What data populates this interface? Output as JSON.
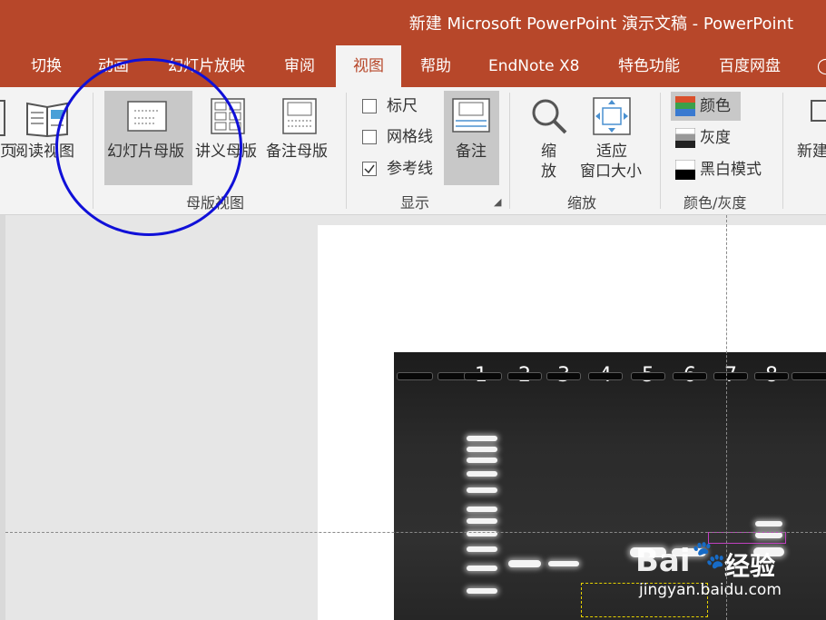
{
  "window": {
    "title": "新建 Microsoft PowerPoint 演示文稿 - PowerPoint"
  },
  "tabs": [
    "切换",
    "动画",
    "幻灯片放映",
    "审阅",
    "视图",
    "帮助",
    "EndNote X8",
    "特色功能",
    "百度网盘"
  ],
  "active_tab": "视图",
  "ribbon": {
    "page_partial": "页",
    "reading_view": "阅读视图",
    "master_views": {
      "slide_master": "幻灯片母版",
      "handout_master": "讲义母版",
      "notes_master": "备注母版",
      "group_label": "母版视图"
    },
    "show": {
      "ruler": "标尺",
      "ruler_checked": false,
      "gridlines": "网格线",
      "gridlines_checked": false,
      "guides": "参考线",
      "guides_checked": true,
      "notes": "备注",
      "group_label": "显示"
    },
    "zoom": {
      "zoom_line1": "缩",
      "zoom_line2": "放",
      "fit_line1": "适应",
      "fit_line2": "窗口大小",
      "group_label": "缩放"
    },
    "color": {
      "color": "颜色",
      "grayscale": "灰度",
      "bw": "黑白模式",
      "group_label": "颜色/灰度"
    },
    "new_partial": "新建"
  },
  "gel": {
    "lanes": [
      "1",
      "2",
      "3",
      "4",
      "5",
      "6",
      "7",
      "8"
    ]
  },
  "watermark": {
    "brand_a": "Bai",
    "brand_b": "经验",
    "url": "jingyan.baidu.com"
  },
  "colors": {
    "ppt_accent": "#b7472a",
    "annotation_circle": "#1010d8",
    "selection_box_yellow": "#e6d200",
    "selection_box_magenta": "#c040c0"
  }
}
